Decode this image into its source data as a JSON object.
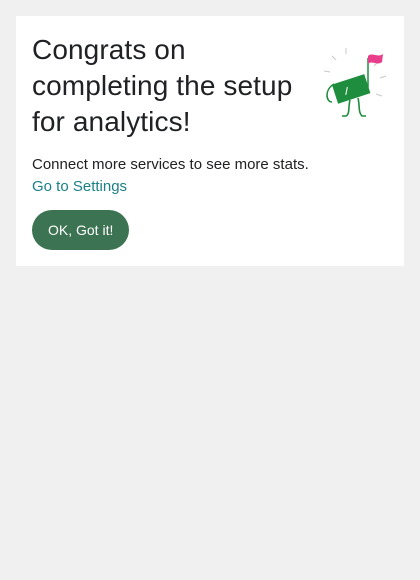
{
  "card": {
    "title": "Congrats on completing the setup for analytics!",
    "description": "Connect more services to see more stats.",
    "settings_link_label": "Go to Settings",
    "ok_button_label": "OK, Got it!"
  },
  "colors": {
    "background": "#f0f0f0",
    "card": "#ffffff",
    "title_text": "#202124",
    "link": "#1a7f86",
    "button": "#3c7352",
    "flag_pink": "#e83e8c",
    "illustration_green": "#1e8e3e"
  },
  "icons": {
    "illustration": "celebration-flag-icon"
  }
}
